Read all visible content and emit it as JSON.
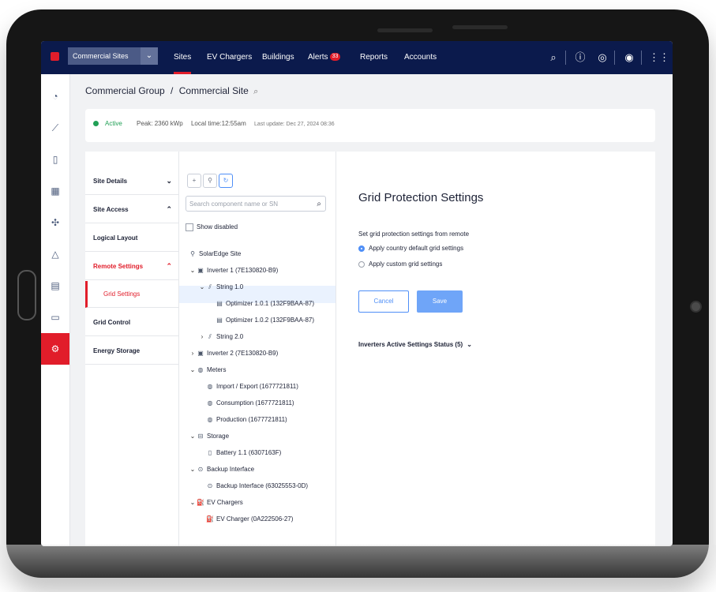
{
  "topnav": {
    "site_select": "Commercial Sites",
    "tabs": [
      {
        "label": "Sites"
      },
      {
        "label": "EV Chargers"
      },
      {
        "label": "Buildings"
      },
      {
        "label": "Alerts",
        "badge": "33"
      },
      {
        "label": "Reports"
      },
      {
        "label": "Accounts"
      }
    ],
    "active_tab": "Sites",
    "icons": [
      "search-icon",
      "help-icon",
      "support-icon",
      "user-icon",
      "apps-icon"
    ]
  },
  "rail": {
    "icons": [
      "dashboard-icon",
      "chart-icon",
      "devices-icon",
      "layout-icon",
      "network-icon",
      "alert-icon",
      "report-icon",
      "document-icon",
      "settings-icon"
    ],
    "active": "settings-icon"
  },
  "breadcrumb": {
    "group": "Commercial Group",
    "separator": "/",
    "site": "Commercial Site"
  },
  "status": {
    "state": "Active",
    "peak": "Peak: 2360 kWp",
    "local_time": "Local time:12:55am",
    "last_update": "Last update: Dec 27, 2024 08:36"
  },
  "menu": {
    "items": [
      {
        "label": "Site Details",
        "caret": "⌄"
      },
      {
        "label": "Site Access",
        "caret": "⌃"
      },
      {
        "label": "Logical Layout",
        "caret": ""
      },
      {
        "label": "Remote Settings",
        "caret": "⌃"
      },
      {
        "label": "Grid Control",
        "caret": ""
      },
      {
        "label": "Energy Storage",
        "caret": ""
      }
    ],
    "sub_item": "Grid Settings"
  },
  "tree": {
    "search_placeholder": "Search component name or SN",
    "show_disabled": "Show disabled",
    "nodes": [
      {
        "label": "SolarEdge Site",
        "icon": "pin-icon",
        "arrow": ""
      },
      {
        "label": "Inverter 1 (7E130820-B9)",
        "icon": "inverter-icon",
        "arrow": "⌄"
      },
      {
        "label": "String 1.0",
        "icon": "string-icon",
        "arrow": "⌄"
      },
      {
        "label": "Optimizer  1.0.1 (132F9BAA-87)",
        "icon": "optimizer-icon",
        "arrow": ""
      },
      {
        "label": "Optimizer  1.0.2 (132F9BAA-87)",
        "icon": "optimizer-icon",
        "arrow": ""
      },
      {
        "label": "String 2.0",
        "icon": "string-icon",
        "arrow": "›"
      },
      {
        "label": "Inverter 2 (7E130820-B9)",
        "icon": "inverter-icon",
        "arrow": "›"
      },
      {
        "label": "Meters",
        "icon": "meter-icon",
        "arrow": "⌄"
      },
      {
        "label": "Import / Export (1677721811)",
        "icon": "meter-icon",
        "arrow": ""
      },
      {
        "label": "Consumption (1677721811)",
        "icon": "meter-icon",
        "arrow": ""
      },
      {
        "label": "Production (1677721811)",
        "icon": "meter-icon",
        "arrow": ""
      },
      {
        "label": "Storage",
        "icon": "storage-icon",
        "arrow": "⌄"
      },
      {
        "label": "Battery 1.1 (6307163F)",
        "icon": "battery-icon",
        "arrow": ""
      },
      {
        "label": "Backup Interface",
        "icon": "backup-icon",
        "arrow": "⌄"
      },
      {
        "label": "Backup Interface (63025553-0D)",
        "icon": "backup-icon",
        "arrow": ""
      },
      {
        "label": "EV Chargers",
        "icon": "ev-charger-icon",
        "arrow": "⌄"
      },
      {
        "label": "EV Charger (0A222506-27)",
        "icon": "ev-charger-icon",
        "arrow": ""
      }
    ]
  },
  "content": {
    "title": "Grid Protection Settings",
    "subtitle": "Set grid protection settings from remote",
    "options": [
      "Apply country default grid settings",
      "Apply custom grid settings"
    ],
    "selected_option": "Apply country default grid settings",
    "cancel_label": "Cancel",
    "save_label": "Save",
    "inverters_status": "Inverters Active Settings Status (5)"
  },
  "colors": {
    "nav_bg": "#0b1a4c",
    "accent_red": "#e11d2a",
    "accent_blue": "#4f8ff7",
    "active_green": "#21a056"
  }
}
